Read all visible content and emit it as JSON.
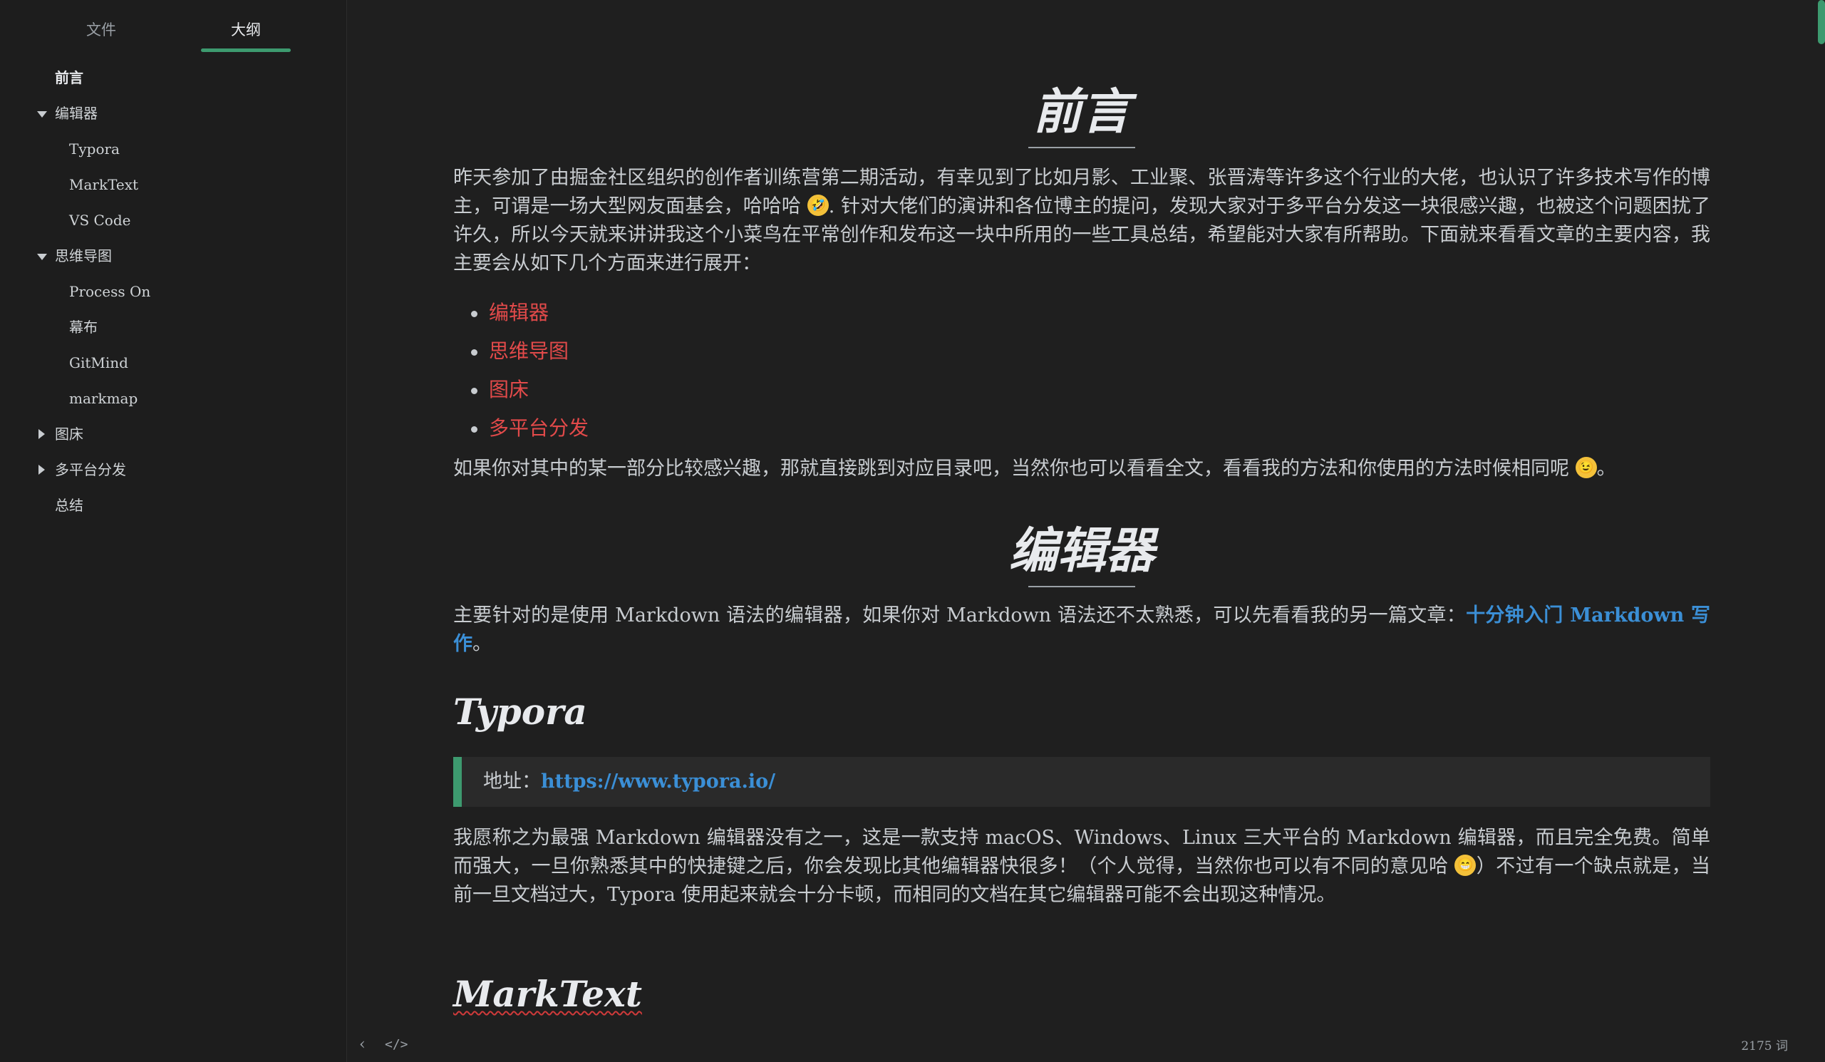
{
  "sidebar": {
    "tabs": [
      "文件",
      "大纲"
    ],
    "outline": [
      {
        "label": "前言",
        "level": 1,
        "toggle": "none",
        "active": true
      },
      {
        "label": "编辑器",
        "level": 1,
        "toggle": "down"
      },
      {
        "label": "Typora",
        "level": 2
      },
      {
        "label": "MarkText",
        "level": 2
      },
      {
        "label": "VS Code",
        "level": 2
      },
      {
        "label": "思维导图",
        "level": 1,
        "toggle": "down"
      },
      {
        "label": "Process On",
        "level": 2
      },
      {
        "label": "幕布",
        "level": 2
      },
      {
        "label": "GitMind",
        "level": 2
      },
      {
        "label": "markmap",
        "level": 2
      },
      {
        "label": "图床",
        "level": 1,
        "toggle": "right"
      },
      {
        "label": "多平台分发",
        "level": 1,
        "toggle": "right"
      },
      {
        "label": "总结",
        "level": 1,
        "toggle": "none"
      }
    ]
  },
  "content": {
    "h1_preface": "前言",
    "intro_p1": "昨天参加了由掘金社区组织的创作者训练营第二期活动，有幸见到了比如月影、工业聚、张晋涛等许多这个行业的大佬，也认识了许多技术写作的博主，可谓是一场大型网友面基会，哈哈哈",
    "intro_p2": ". 针对大佬们的演讲和各位博主的提问，发现大家对于多平台分发这一块很感兴趣，也被这个问题困扰了许久，所以今天就来讲讲我这个小菜鸟在平常创作和发布这一块中所用的一些工具总结，希望能对大家有所帮助。下面就来看看文章的主要内容，我主要会从如下几个方面来进行展开：",
    "toc": [
      "编辑器",
      "思维导图",
      "图床",
      "多平台分发"
    ],
    "after_toc": "如果你对其中的某一部分比较感兴趣，那就直接跳到对应目录吧，当然你也可以看看全文，看看我的方法和你使用的方法时候相同呢",
    "after_toc_end": "。",
    "h1_editor": "编辑器",
    "editor_p_a": "主要针对的是使用 Markdown 语法的编辑器，如果你对 Markdown 语法还不太熟悉，可以先看看我的另一篇文章：",
    "editor_link": "十分钟入门 Markdown 写作",
    "editor_p_end": "。",
    "h2_typora": "Typora",
    "quote_label": "地址：",
    "quote_link": "https://www.typora.io/",
    "typora_p1": "我愿称之为最强 Markdown 编辑器没有之一，这是一款支持 macOS、Windows、Linux 三大平台的 Markdown 编辑器，而且完全免费。简单而强大，一旦你熟悉其中的快捷键之后，你会发现比其他编辑器快很多！（个人觉得，当然你也可以有不同的意见哈",
    "typora_p2": "）不过有一个缺点就是，当前一旦文档过大，Typora 使用起来就会十分卡顿，而相同的文档在其它编辑器可能不会出现这种情况。",
    "h2_marktext": "MarkText",
    "emoji_laugh": "🤣",
    "emoji_wink": "😉",
    "emoji_grin": "😁"
  },
  "footer": {
    "back_icon": "‹",
    "code_icon": "</>",
    "word_count": "2175 词"
  },
  "colors": {
    "accent": "#3d9a6f",
    "link": "#3b8fd6",
    "toc_red": "#e24a4a"
  }
}
